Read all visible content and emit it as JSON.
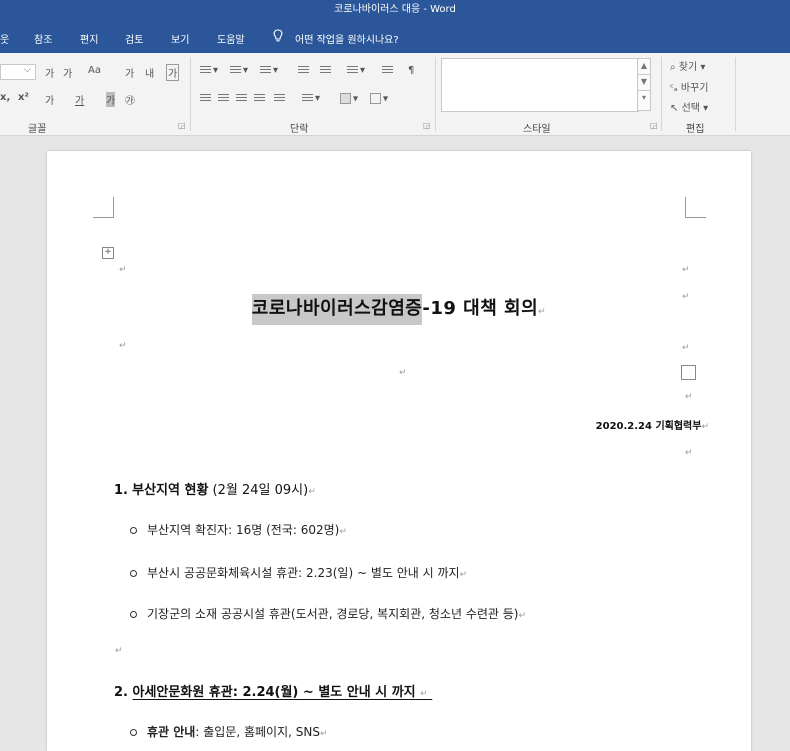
{
  "window": {
    "title": "코로나바이러스 대응  -  Word"
  },
  "menu": {
    "items": [
      "웃",
      "참조",
      "편지",
      "검토",
      "보기",
      "도움말"
    ],
    "tell_me": "어떤 작업을 원하시나요?"
  },
  "ribbon": {
    "font": {
      "row1": [
        "가",
        "가",
        "Aa",
        "가",
        "내",
        "가"
      ],
      "row2": [
        "x,",
        "x²",
        "가",
        "가",
        "가",
        "㉮"
      ],
      "label": "글꼴"
    },
    "paragraph": {
      "label": "단락"
    },
    "styles": {
      "label": "스타일"
    },
    "editing": {
      "find": "찾기",
      "replace": "바꾸기",
      "select": "선택",
      "label": "편집"
    }
  },
  "document": {
    "title_highlighted": "코로나바이러스감염증",
    "title_rest": "-19 대책 회의",
    "date_line": "2020.2.24 기획협력부",
    "section1": {
      "number": "1.",
      "heading_bold": "부산지역 현황",
      "heading_rest": " (2월 24일 09시)",
      "bullets": [
        "부산지역 확진자: 16명 (전국: 602명)",
        "부산시 공공문화체육시설 휴관: 2.23(일) ~ 별도 안내 시 까지",
        "기장군의 소재 공공시설 휴관(도서관, 경로당, 복지회관, 청소년 수련관 등)"
      ]
    },
    "section2": {
      "number": "2.",
      "heading_part1": "아세안문화원 휴관",
      "heading_part2": ": 2.24(월) ~ 별도 안내 시 까지",
      "bullet_bold": "휴관 안내",
      "bullet_rest": ": 출입문, 홈페이지, SNS"
    }
  }
}
